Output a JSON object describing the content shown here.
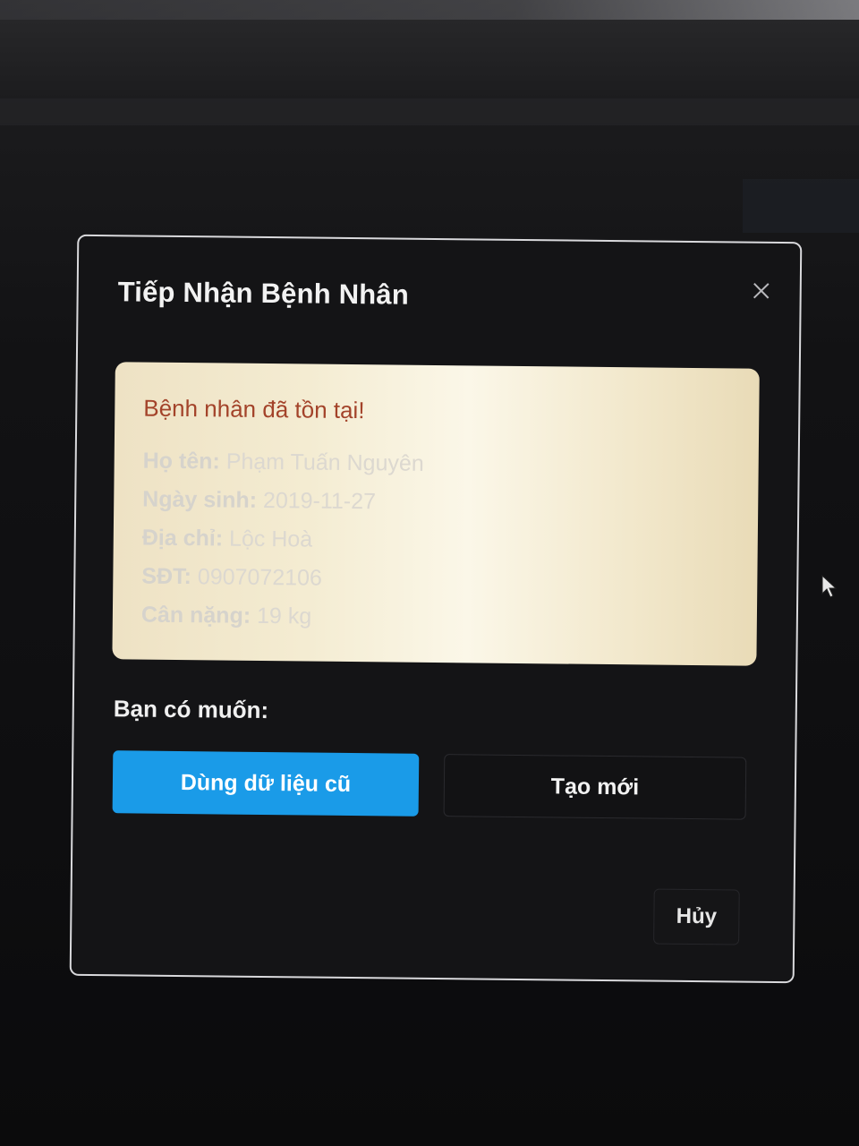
{
  "dialog": {
    "title": "Tiếp Nhận Bệnh Nhân",
    "close_icon": "close-icon"
  },
  "alert": {
    "title": "Bệnh nhân đã tồn tại!",
    "fields": [
      {
        "label": "Họ tên:",
        "value": "Phạm Tuấn Nguyên"
      },
      {
        "label": "Ngày sinh:",
        "value": "2019-11-27"
      },
      {
        "label": "Địa chỉ:",
        "value": "Lộc Hoà"
      },
      {
        "label": "SĐT:",
        "value": "0907072106"
      },
      {
        "label": "Cân nặng:",
        "value": "19 kg"
      }
    ]
  },
  "prompt": {
    "question": "Bạn có muốn:"
  },
  "actions": {
    "use_old_label": "Dùng dữ liệu cũ",
    "create_new_label": "Tạo mới",
    "cancel_label": "Hủy"
  },
  "colors": {
    "primary": "#1a9be8",
    "alert_title": "#a3432a",
    "alert_bg": "#f4ecd2"
  }
}
